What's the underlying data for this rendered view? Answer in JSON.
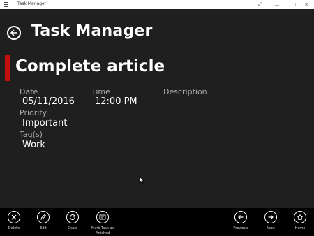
{
  "window": {
    "title": "Task Manager",
    "menu_icon": "hamburger-icon",
    "controls": [
      "expand-icon",
      "minimize-icon",
      "maximize-icon",
      "close-icon"
    ]
  },
  "header": {
    "back_icon": "back-arrow-icon",
    "title": "Task Manager"
  },
  "task": {
    "title": "Complete article",
    "accent_color": "#c40d0d",
    "fields": {
      "date_label": "Date",
      "date_value": "05/11/2016",
      "time_label": "Time",
      "time_value": "12:00 PM",
      "description_label": "Description",
      "priority_label": "Priority",
      "priority_value": "Important",
      "tags_label": "Tag(s)",
      "tags_value": "Work"
    }
  },
  "appbar": {
    "left": [
      {
        "label": "Delete",
        "icon": "delete-icon"
      },
      {
        "label": "Edit",
        "icon": "edit-icon"
      },
      {
        "label": "Share",
        "icon": "share-icon"
      },
      {
        "label": "Mark Task as Finished",
        "icon": "mark-finished-icon"
      }
    ],
    "right": [
      {
        "label": "Previous",
        "icon": "previous-icon"
      },
      {
        "label": "Next",
        "icon": "next-icon"
      },
      {
        "label": "Home",
        "icon": "home-icon"
      }
    ]
  },
  "colors": {
    "background": "#1f1f1f",
    "appbar": "#000000",
    "accent": "#c40d0d"
  }
}
